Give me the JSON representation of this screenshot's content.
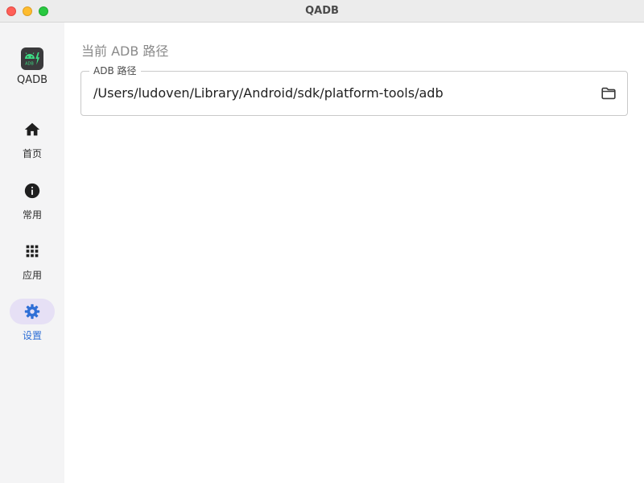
{
  "window": {
    "title": "QADB"
  },
  "sidebar": {
    "app_name": "QADB",
    "logo_text": "ADB",
    "items": [
      {
        "label": "首页",
        "icon": "home-icon",
        "active": false
      },
      {
        "label": "常用",
        "icon": "info-icon",
        "active": false
      },
      {
        "label": "应用",
        "icon": "apps-grid-icon",
        "active": false
      },
      {
        "label": "设置",
        "icon": "settings-gear-icon",
        "active": true
      }
    ]
  },
  "main": {
    "section_title": "当前 ADB 路径",
    "adb_field": {
      "label": "ADB 路径",
      "value": "/Users/ludoven/Library/Android/sdk/platform-tools/adb",
      "action_icon": "folder-icon"
    }
  },
  "colors": {
    "accent": "#2f6fd6",
    "active_pill": "#e6e0f5",
    "sidebar_bg": "#f4f4f5",
    "logo_bg": "#3a3a3c",
    "logo_android": "#3ddc84"
  }
}
